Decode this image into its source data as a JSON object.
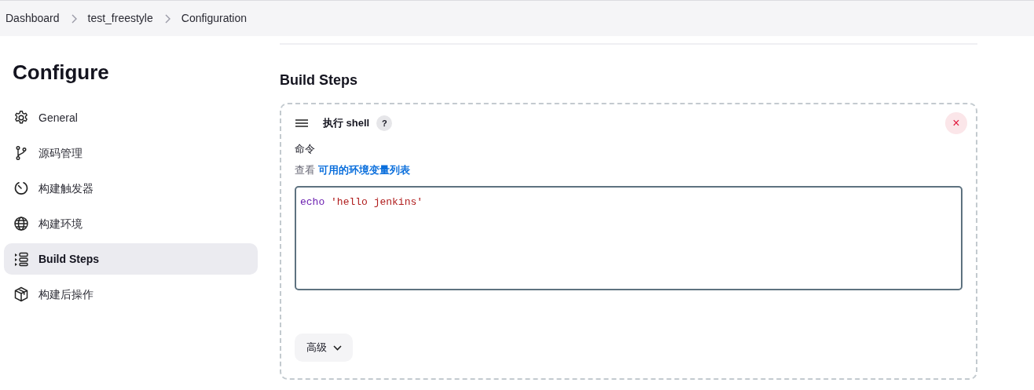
{
  "breadcrumbs": [
    "Dashboard",
    "test_freestyle",
    "Configuration"
  ],
  "sidebar": {
    "title": "Configure",
    "items": [
      {
        "label": "General",
        "kind": "gear",
        "selected": false
      },
      {
        "label": "源码管理",
        "kind": "branch",
        "selected": false
      },
      {
        "label": "构建触发器",
        "kind": "timer",
        "selected": false
      },
      {
        "label": "构建环境",
        "kind": "globe",
        "selected": false
      },
      {
        "label": "Build Steps",
        "kind": "steps",
        "selected": true
      },
      {
        "label": "构建后操作",
        "kind": "package",
        "selected": false
      }
    ]
  },
  "section": {
    "title": "Build Steps",
    "step": {
      "title": "执行 shell",
      "help": "?",
      "delete": "×",
      "field_label": "命令",
      "hint_prefix": "查看",
      "hint_link": "可用的环境变量列表",
      "command": [
        {
          "text": "echo",
          "kind": "keyword"
        },
        {
          "text": "'hello jenkins'",
          "kind": "string"
        }
      ],
      "advanced": "高级"
    }
  }
}
